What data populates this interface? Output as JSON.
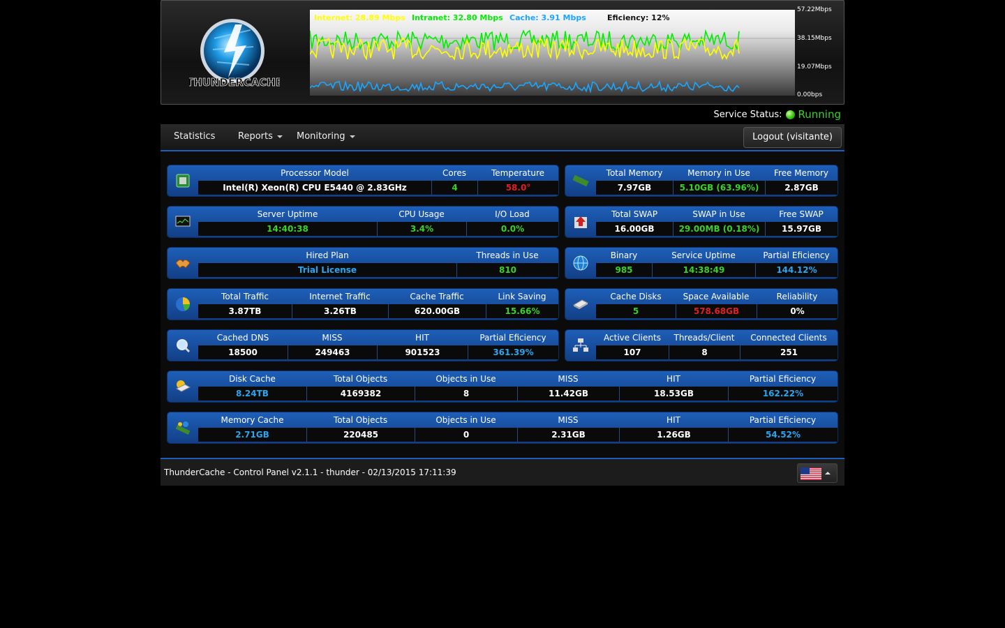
{
  "header": {
    "logo_text": "THUNDERCACHE",
    "legend": {
      "internet": "Internet: 28.89 Mbps",
      "intranet": "Intranet: 32.80 Mbps",
      "cache": "Cache: 3.91 Mbps",
      "efficiency": "Eficiency: 12%"
    },
    "y_ticks": [
      "57.22Mbps",
      "38.15Mbps",
      "19.07Mbps",
      "0.00bps"
    ],
    "colors": {
      "internet": "#ffff00",
      "intranet": "#00ee00",
      "cache": "#1aa6ff"
    }
  },
  "status": {
    "label": "Service Status:",
    "value": "Running"
  },
  "nav": {
    "statistics": "Statistics",
    "reports": "Reports",
    "monitoring": "Monitoring",
    "logout": "Logout (visitante)"
  },
  "cards": {
    "processor": {
      "icon": "cpu-chip-icon",
      "h": [
        "Processor Model",
        "Cores",
        "Temperature"
      ],
      "v": [
        "Intel(R) Xeon(R) CPU E5440 @ 2.83GHz",
        "4",
        "58.0°"
      ]
    },
    "memory": {
      "icon": "memory-ram-icon",
      "h": [
        "Total Memory",
        "Memory in Use",
        "Free Memory"
      ],
      "v": [
        "7.97GB",
        "5.10GB (63.96%)",
        "2.87GB"
      ]
    },
    "uptime": {
      "icon": "monitor-graph-icon",
      "h": [
        "Server Uptime",
        "CPU Usage",
        "I/O Load"
      ],
      "v": [
        "14:40:38",
        "3.4%",
        "0.0%"
      ]
    },
    "swap": {
      "icon": "swap-upload-icon",
      "h": [
        "Total SWAP",
        "SWAP in Use",
        "Free SWAP"
      ],
      "v": [
        "16.00GB",
        "29.00MB (0.18%)",
        "15.97GB"
      ]
    },
    "plan": {
      "icon": "handshake-icon",
      "h": [
        "Hired Plan",
        "Threads in Use"
      ],
      "v": [
        "Trial License",
        "810"
      ]
    },
    "binary": {
      "icon": "globe-icon",
      "h": [
        "Binary",
        "Service Uptime",
        "Partial Eficiency"
      ],
      "v": [
        "985",
        "14:38:49",
        "144.12%"
      ]
    },
    "traffic": {
      "icon": "pie-chart-icon",
      "h": [
        "Total Traffic",
        "Internet Traffic",
        "Cache Traffic",
        "Link Saving"
      ],
      "v": [
        "3.87TB",
        "3.26TB",
        "620.00GB",
        "15.66%"
      ]
    },
    "disks": {
      "icon": "hard-disk-icon",
      "h": [
        "Cache Disks",
        "Space Available",
        "Reliability"
      ],
      "v": [
        "5",
        "578.68GB",
        "0%"
      ]
    },
    "dns": {
      "icon": "dns-search-icon",
      "h": [
        "Cached DNS",
        "MISS",
        "HIT",
        "Partial Eficiency"
      ],
      "v": [
        "18500",
        "249463",
        "901523",
        "361.39%"
      ]
    },
    "clients": {
      "icon": "network-clients-icon",
      "h": [
        "Active Clients",
        "Threads/Client",
        "Connected Clients"
      ],
      "v": [
        "107",
        "8",
        "251"
      ]
    },
    "diskcache": {
      "icon": "disk-cache-icon",
      "h": [
        "Disk Cache",
        "Total Objects",
        "Objects in Use",
        "MISS",
        "HIT",
        "Partial Eficiency"
      ],
      "v": [
        "8.24TB",
        "4169382",
        "8",
        "11.42GB",
        "18.53GB",
        "162.22%"
      ]
    },
    "memcache": {
      "icon": "memory-cache-icon",
      "h": [
        "Memory Cache",
        "Total Objects",
        "Objects in Use",
        "MISS",
        "HIT",
        "Partial Eficiency"
      ],
      "v": [
        "2.71GB",
        "220485",
        "0",
        "2.31GB",
        "1.26GB",
        "54.52%"
      ]
    }
  },
  "footer": {
    "text": "ThunderCache - Control Panel v2.1.1 - thunder - 02/13/2015 17:11:39",
    "flag": "us-flag-icon"
  }
}
